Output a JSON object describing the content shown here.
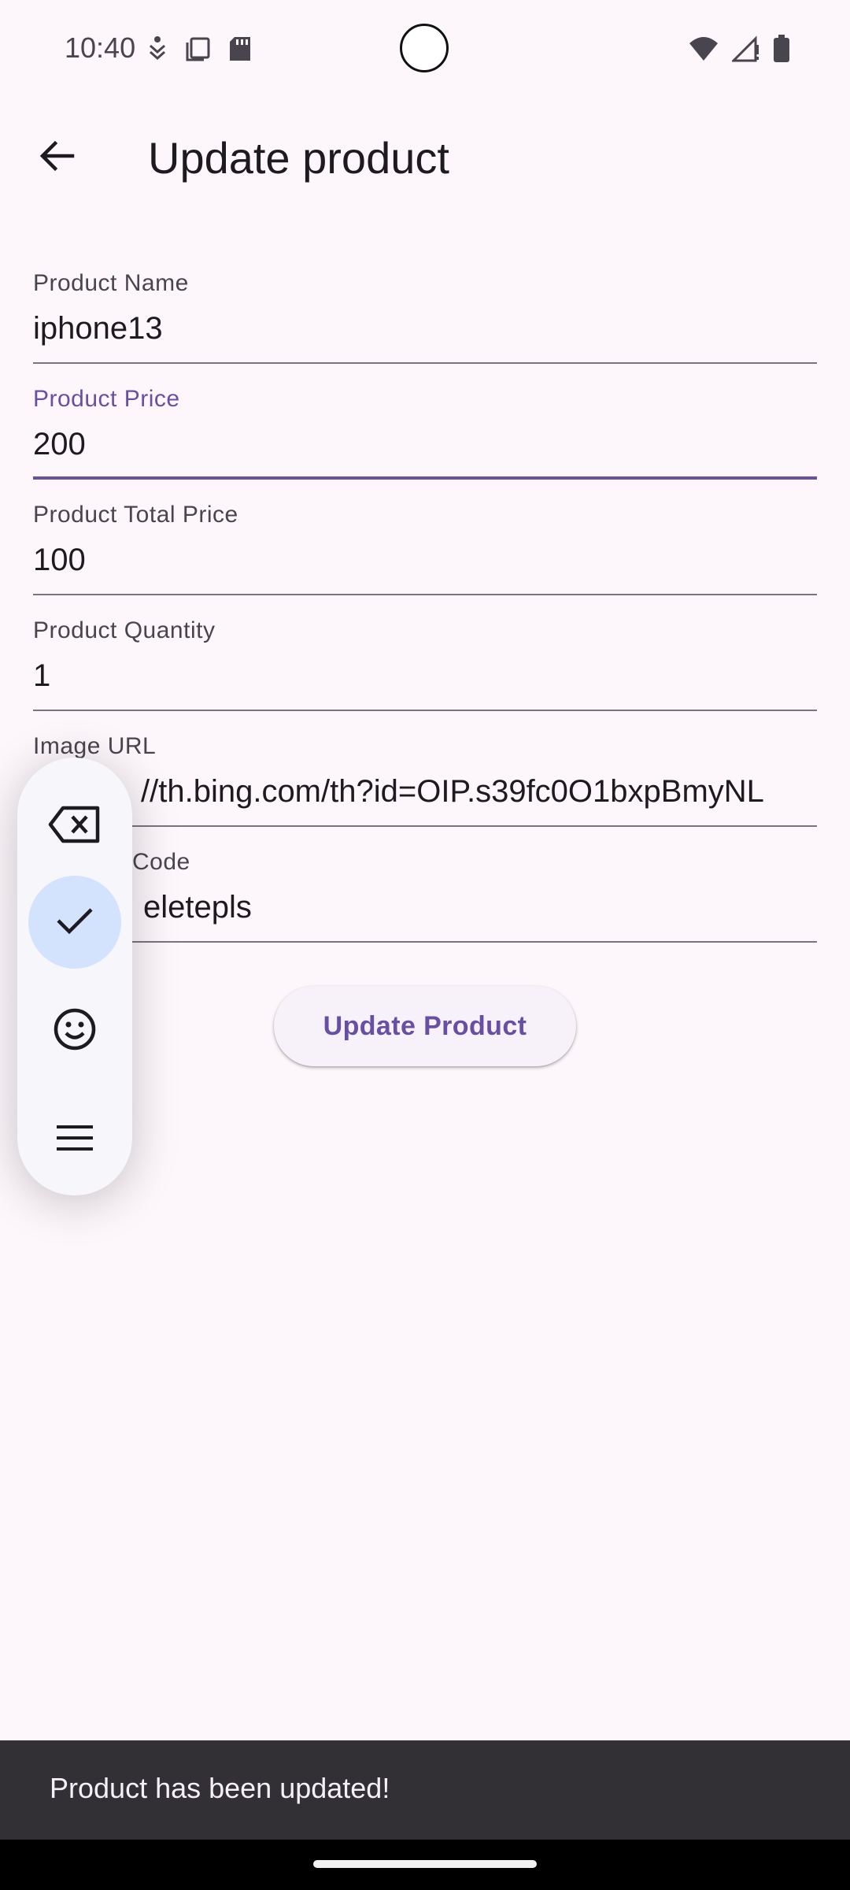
{
  "status_bar": {
    "time": "10:40",
    "left_icons": [
      "accessibility-icon",
      "copy-icon",
      "sd-card-icon"
    ],
    "right_icons": [
      "wifi-icon",
      "cell-signal-icon",
      "battery-icon"
    ]
  },
  "app_bar": {
    "title": "Update product",
    "back_icon": "arrow-back-icon"
  },
  "form": {
    "fields": [
      {
        "label": "Product Name",
        "value": "iphone13"
      },
      {
        "label": "Product Price",
        "value": "200"
      },
      {
        "label": "Product Total Price",
        "value": "100"
      },
      {
        "label": "Product Quantity",
        "value": "1"
      },
      {
        "label": "Image URL",
        "value": "//th.bing.com/th?id=OIP.s39fc0O1bxpBmyNL"
      },
      {
        "label": "Code",
        "value": "eletepls"
      }
    ],
    "focused_field": "Product Price",
    "submit_label": "Update Product"
  },
  "floating_toolbar": {
    "items": [
      "backspace-icon",
      "check-icon",
      "emoji-icon",
      "menu-icon"
    ],
    "active_item": "check-icon"
  },
  "snackbar": {
    "message": "Product has been updated!"
  },
  "colors": {
    "primary": "#6750a4",
    "background": "#fdf7fc",
    "snackbar": "#322f35",
    "toolbar_active": "#d3e3fd"
  }
}
